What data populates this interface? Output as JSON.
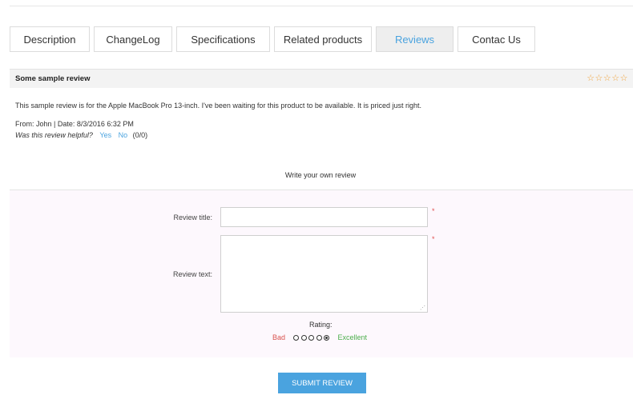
{
  "tabs": [
    {
      "label": "Description"
    },
    {
      "label": "ChangeLog"
    },
    {
      "label": "Specifications"
    },
    {
      "label": "Related products"
    },
    {
      "label": "Reviews"
    },
    {
      "label": "Contac Us"
    }
  ],
  "review": {
    "title": "Some sample review",
    "stars": "☆☆☆☆☆",
    "rating": 5,
    "body": "This sample review is for the Apple MacBook Pro 13-inch. I've been waiting for this product to be available. It is priced just right.",
    "meta": "From: John | Date: 8/3/2016 6:32 PM",
    "helpful_question": "Was this review helpful?",
    "yes": "Yes",
    "no": "No",
    "helpful_count": "(0/0)"
  },
  "form": {
    "heading": "Write your own review",
    "title_label": "Review title:",
    "title_value": "",
    "text_label": "Review text:",
    "text_value": "",
    "required_mark": "*",
    "rating_label": "Rating:",
    "bad_label": "Bad",
    "excellent_label": "Excellent",
    "selected_rating": 5,
    "submit_label": "SUBMIT REVIEW"
  },
  "colors": {
    "accent": "#4aa3df",
    "star": "#f0a23a",
    "bad": "#d9534f",
    "excellent": "#4cae4c"
  }
}
